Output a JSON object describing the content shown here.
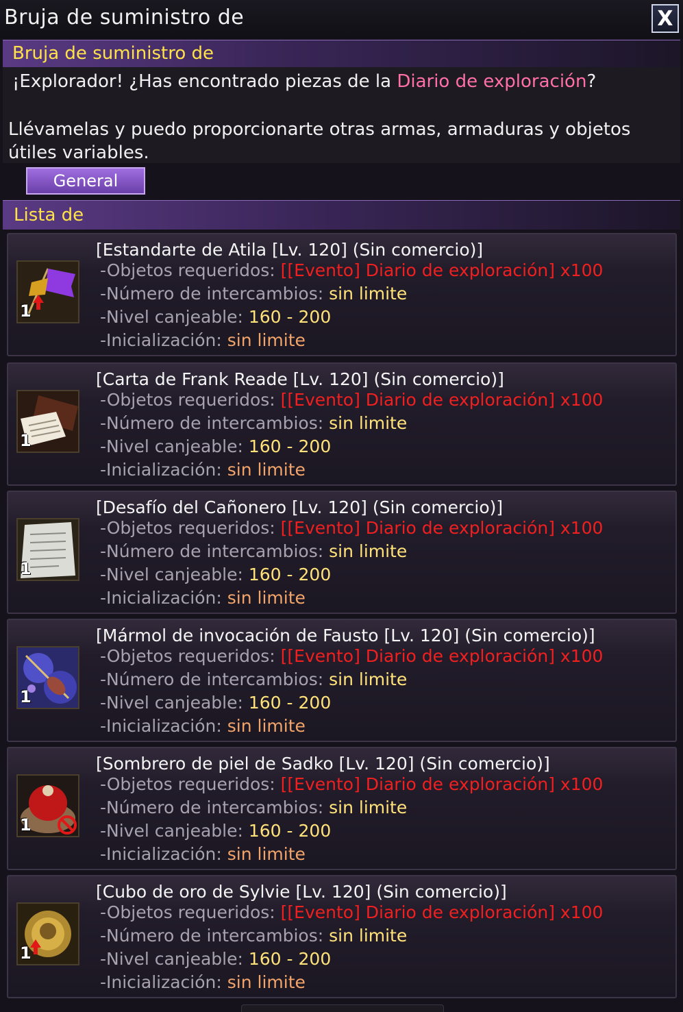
{
  "window": {
    "title": "Bruja de suministro de",
    "close_label": "X"
  },
  "npc": {
    "name": "Bruja de suministro de",
    "dialog_pre": "¡Explorador! ¿Has encontrado piezas de la ",
    "dialog_highlight": "Diario de exploración",
    "dialog_post": "?",
    "dialog_line2": "Llévamelas y puedo proporcionarte otras armas, armaduras y objetos útiles variables."
  },
  "tabs": [
    {
      "label": "General",
      "active": true
    }
  ],
  "list": {
    "title": "Lista de",
    "labels": {
      "required": "-Objetos requeridos:",
      "exchanges": "-Número de intercambios:",
      "level": "-Nivel canjeable:",
      "reset": "-Inicialización:"
    },
    "items": [
      {
        "name": "[Estandarte de Atila [Lv. 120] (Sin comercio)]",
        "required": "[[Evento] Diario de exploración] x100",
        "exchanges": "sin limite",
        "level": "160 - 200",
        "reset": "sin limite",
        "quantity": "1",
        "icon": "purple-flag-icon"
      },
      {
        "name": "[Carta de Frank Reade [Lv. 120] (Sin comercio)]",
        "required": "[[Evento] Diario de exploración] x100",
        "exchanges": "sin limite",
        "level": "160 - 200",
        "reset": "sin limite",
        "quantity": "1",
        "icon": "letter-icon"
      },
      {
        "name": "[Desafío del Cañonero [Lv. 120] (Sin comercio)]",
        "required": "[[Evento] Diario de exploración] x100",
        "exchanges": "sin limite",
        "level": "160 - 200",
        "reset": "sin limite",
        "quantity": "1",
        "icon": "paper-sheet-icon"
      },
      {
        "name": "[Mármol de invocación de Fausto [Lv. 120] (Sin comercio)]",
        "required": "[[Evento] Diario de exploración] x100",
        "exchanges": "sin limite",
        "level": "160 - 200",
        "reset": "sin limite",
        "quantity": "1",
        "icon": "violin-marble-icon"
      },
      {
        "name": "[Sombrero de piel de Sadko [Lv. 120] (Sin comercio)]",
        "required": "[[Evento] Diario de exploración] x100",
        "exchanges": "sin limite",
        "level": "160 - 200",
        "reset": "sin limite",
        "quantity": "1",
        "icon": "fur-hat-icon"
      },
      {
        "name": "[Cubo de oro de Sylvie [Lv. 120] (Sin comercio)]",
        "required": "[[Evento] Diario de exploración] x100",
        "exchanges": "sin limite",
        "level": "160 - 200",
        "reset": "sin limite",
        "quantity": "1",
        "icon": "gold-cube-icon"
      }
    ]
  },
  "colors": {
    "header_yellow": "#ffe24a",
    "highlight_pink": "#ff6fa8",
    "required_red": "#ee2020",
    "value_yellow": "#ffe27a",
    "reset_orange": "#f3a46a",
    "tab_purple": "#8a5ac8"
  }
}
